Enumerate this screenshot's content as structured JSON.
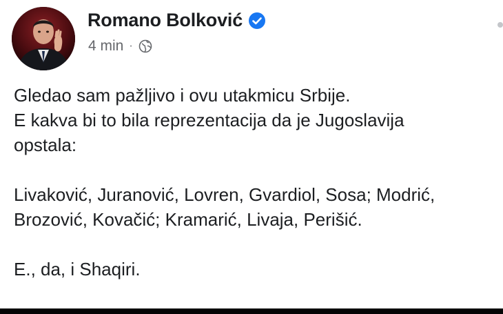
{
  "post": {
    "author": "Romano Bolković",
    "time": "4 min",
    "separator": "·",
    "icons": {
      "verified": "verified-badge-icon",
      "audience": "globe-icon",
      "menu": "more-options-icon"
    },
    "colors": {
      "verified": "#1877f2",
      "meta": "#65676b",
      "text": "#1c1e21"
    },
    "lines": {
      "l1": "Gledao sam pažljivo i ovu utakmicu Srbije.",
      "l2": "E kakva bi to bila reprezentacija da je Jugoslavija",
      "l3": "opstala:",
      "l4": "Livaković, Juranović, Lovren, Gvardiol, Sosa; Modrić,",
      "l5": "Brozović, Kovačić; Kramarić, Livaja, Perišić.",
      "l6": "E., da, i Shaqiri."
    }
  }
}
